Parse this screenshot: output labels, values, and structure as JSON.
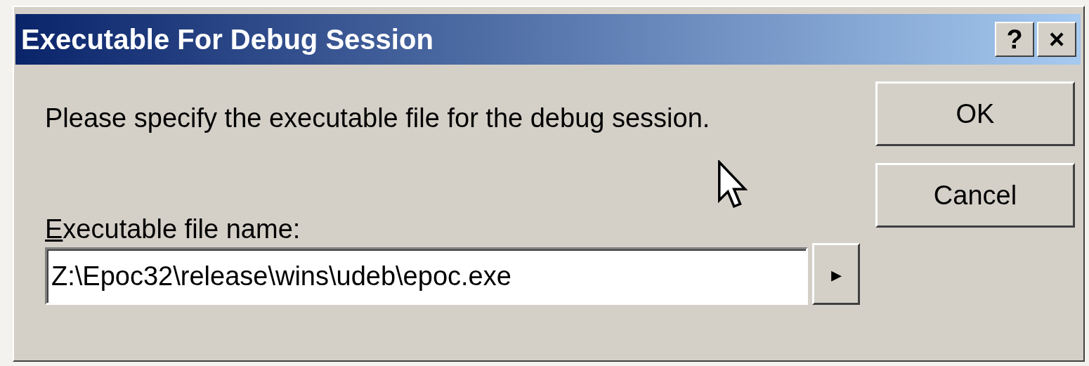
{
  "window": {
    "title": "Executable For Debug Session",
    "title_buttons": [
      "?",
      "×"
    ]
  },
  "prompt": "Please specify the executable file for the debug session.",
  "field": {
    "label": "Executable file name:",
    "value": "Z:\\Epoc32\\release\\wins\\udeb\\epoc.exe",
    "browse": "▸"
  },
  "buttons": [
    "OK",
    "Cancel"
  ]
}
